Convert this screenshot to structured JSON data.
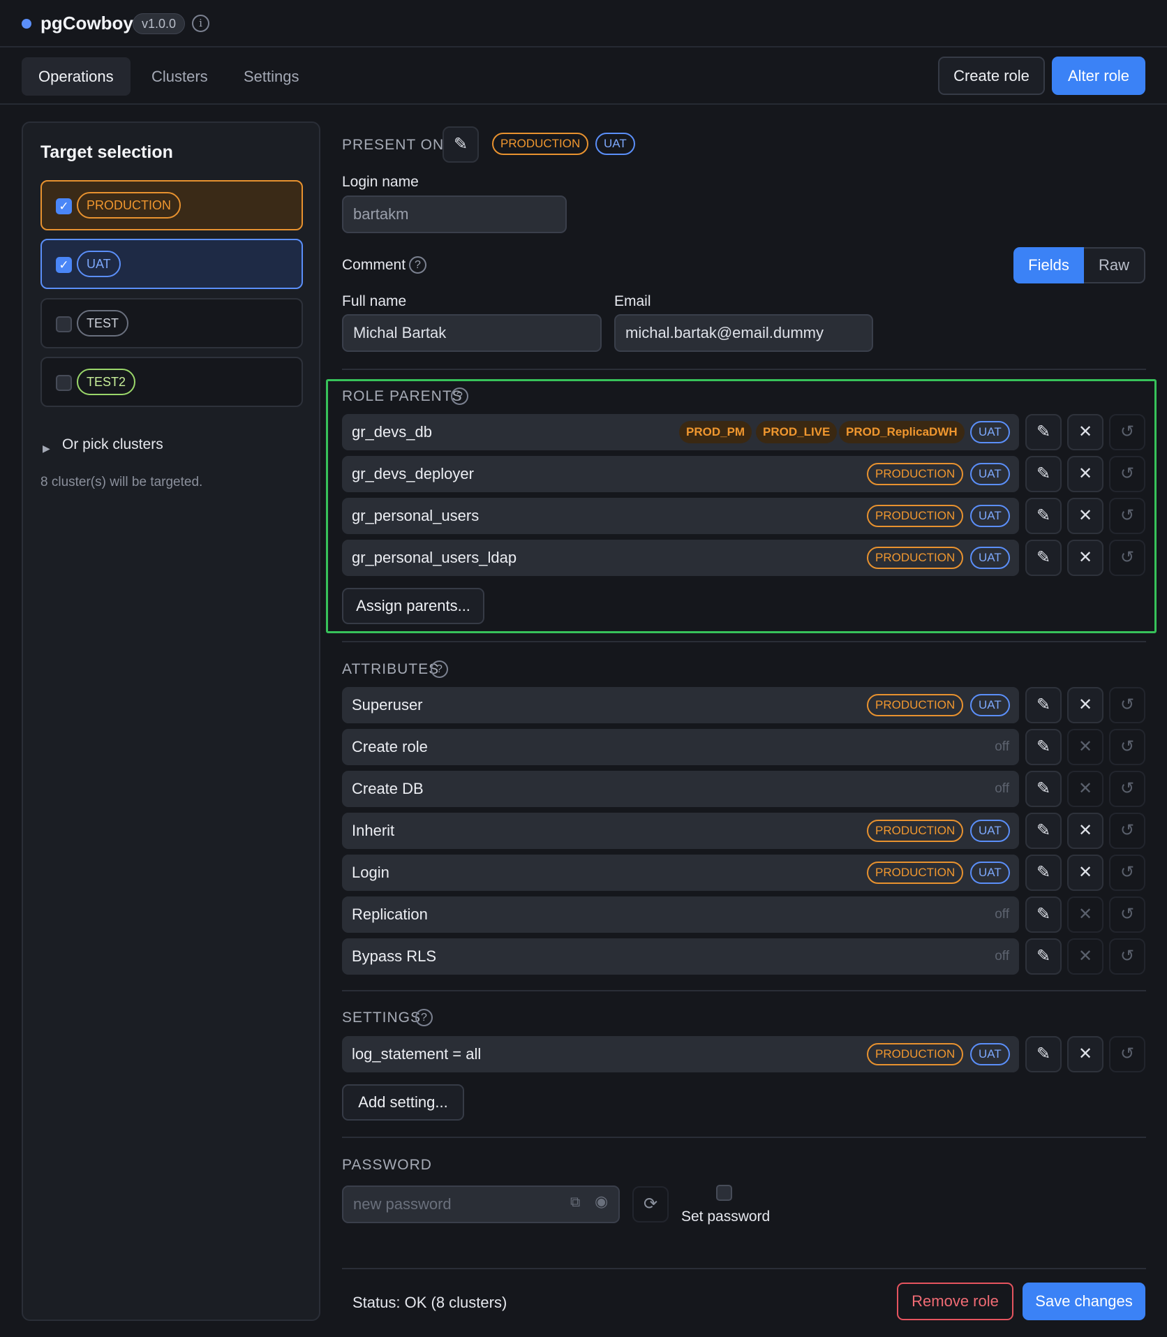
{
  "header": {
    "app_name": "pgCowboy",
    "version": "v1.0.0"
  },
  "nav": {
    "tabs": [
      "Operations",
      "Clusters",
      "Settings"
    ],
    "active_tab": "Operations",
    "create_role_label": "Create role",
    "alter_role_label": "Alter role"
  },
  "sidebar": {
    "title": "Target selection",
    "targets": [
      {
        "label": "PRODUCTION",
        "checked": true
      },
      {
        "label": "UAT",
        "checked": true
      },
      {
        "label": "TEST",
        "checked": false
      },
      {
        "label": "TEST2",
        "checked": false
      }
    ],
    "pick_clusters_label": "Or pick clusters",
    "targeted_text": "8 cluster(s) will be targeted."
  },
  "main": {
    "present_on_label": "PRESENT ON",
    "present_on_tags": [
      "PRODUCTION",
      "UAT"
    ],
    "login_name_label": "Login name",
    "login_name_value": "bartakm",
    "comment_label": "Comment",
    "view_toggle": {
      "fields": "Fields",
      "raw": "Raw",
      "active": "Fields"
    },
    "full_name_label": "Full name",
    "full_name_value": "Michal Bartak",
    "email_label": "Email",
    "email_value": "michal.bartak@email.dummy",
    "role_parents": {
      "label": "ROLE PARENTS",
      "items": [
        {
          "name": "gr_devs_db",
          "tags": [
            "PROD_PM",
            "PROD_LIVE",
            "PROD_ReplicaDWH",
            "UAT"
          ]
        },
        {
          "name": "gr_devs_deployer",
          "tags": [
            "PRODUCTION",
            "UAT"
          ]
        },
        {
          "name": "gr_personal_users",
          "tags": [
            "PRODUCTION",
            "UAT"
          ]
        },
        {
          "name": "gr_personal_users_ldap",
          "tags": [
            "PRODUCTION",
            "UAT"
          ]
        }
      ],
      "assign_label": "Assign parents..."
    },
    "attributes": {
      "label": "ATTRIBUTES",
      "items": [
        {
          "name": "Superuser",
          "state": "PRODUCTION UAT"
        },
        {
          "name": "Create role",
          "state": "off"
        },
        {
          "name": "Create DB",
          "state": "off"
        },
        {
          "name": "Inherit",
          "state": "PRODUCTION UAT"
        },
        {
          "name": "Login",
          "state": "PRODUCTION UAT"
        },
        {
          "name": "Replication",
          "state": "off"
        },
        {
          "name": "Bypass RLS",
          "state": "off"
        }
      ]
    },
    "settings": {
      "label": "SETTINGS",
      "items": [
        {
          "name": "log_statement = all",
          "tags": [
            "PRODUCTION",
            "UAT"
          ]
        }
      ],
      "add_label": "Add setting..."
    },
    "password": {
      "label": "PASSWORD",
      "placeholder": "new password",
      "set_password_label": "Set password"
    },
    "status_text": "Status: OK (8 clusters)",
    "remove_role_label": "Remove role",
    "save_changes_label": "Save changes"
  },
  "colors": {
    "accent_blue": "#3b82f6",
    "production_orange": "#e8922f",
    "uat_blue": "#5b8ff9",
    "highlight_green": "#37c25a",
    "danger_red": "#e5545f"
  }
}
